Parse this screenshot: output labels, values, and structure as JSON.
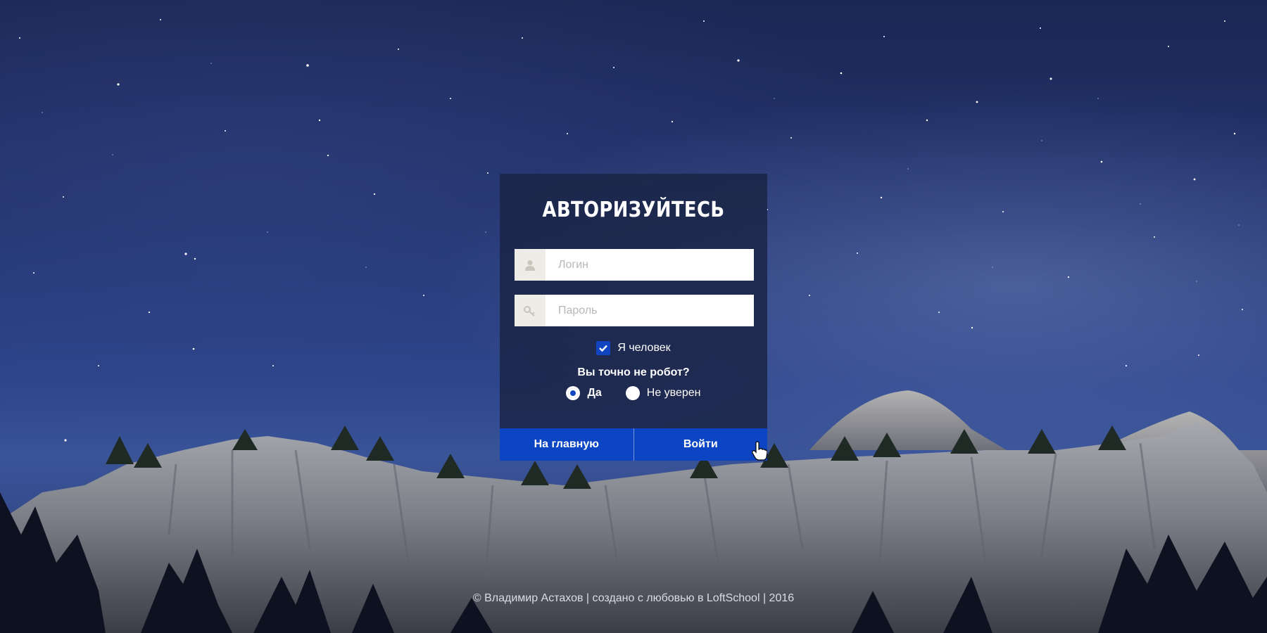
{
  "login_form": {
    "title": "АВТОРИЗУЙТЕСЬ",
    "login_placeholder": "Логин",
    "password_placeholder": "Пароль",
    "human_checkbox_label": "Я человек",
    "human_checked": true,
    "robot_question": "Вы точно не робот?",
    "radio_options": [
      {
        "label": "Да",
        "selected": true
      },
      {
        "label": "Не уверен",
        "selected": false
      }
    ],
    "home_button_label": "На главную",
    "login_button_label": "Войти"
  },
  "icons": {
    "login_field": "user-icon",
    "password_field": "key-icon",
    "checkbox": "checkmark-icon",
    "pointer": "hand-cursor-icon"
  },
  "colors": {
    "accent": "#0b45c4",
    "card_bg": "#1b2648",
    "field_icon_bg": "#eeece6",
    "text": "#ffffff"
  },
  "footer": {
    "text": "© Владимир Астахов | создано с любовью в LoftSchool | 2016"
  }
}
